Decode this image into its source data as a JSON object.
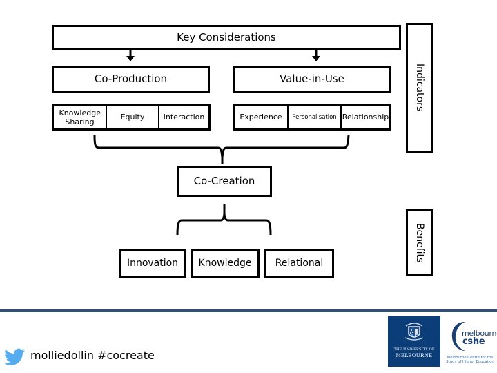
{
  "diagram": {
    "top": {
      "label": "Key Considerations"
    },
    "branches": [
      {
        "label": "Co-Production",
        "items": [
          "Knowledge Sharing",
          "Equity",
          "Interaction"
        ]
      },
      {
        "label": "Value-in-Use",
        "items": [
          "Experience",
          "Personalisation",
          "Relationship"
        ]
      }
    ],
    "merge": {
      "label": "Co-Creation"
    },
    "outcomes": [
      "Innovation",
      "Knowledge",
      "Relational"
    ],
    "side_labels": {
      "indicators": "Indicators",
      "benefits": "Benefits"
    }
  },
  "footer": {
    "twitter_icon": "twitter-bird-icon",
    "handle": "molliedollin #cocreate",
    "accent_color": "#2e4f7a",
    "uom_logo": {
      "line1": "THE UNIVERSITY OF",
      "line2": "MELBOURNE",
      "color": "#0b3d78"
    },
    "cshe_logo": {
      "word1": "melbourne",
      "word2": "cshe",
      "subtitle_line1": "Melbourne Centre for the",
      "subtitle_line2": "Study of Higher Education"
    }
  }
}
